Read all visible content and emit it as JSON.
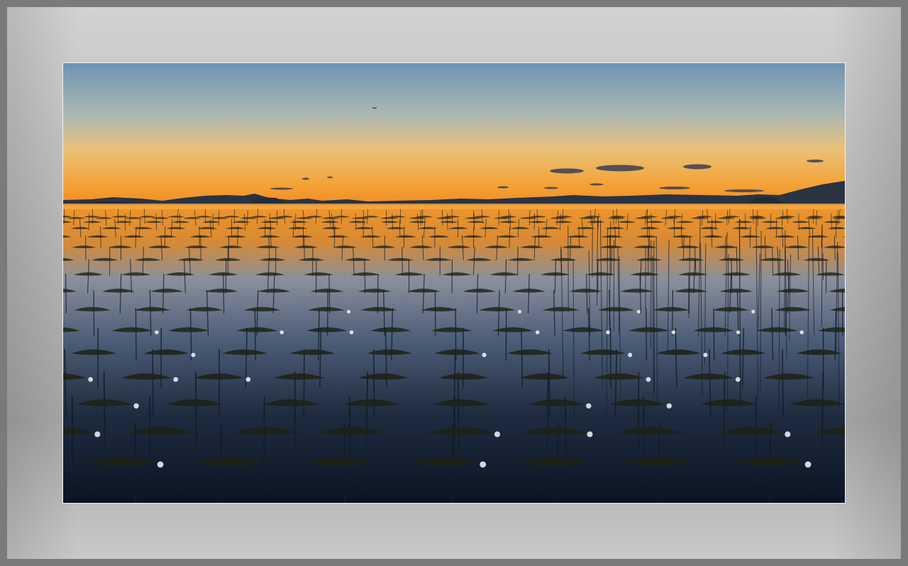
{
  "scene": {
    "subject": "seaweed-farm-at-sunset",
    "colors": {
      "sky_top": "#6f93b3",
      "sky_mid": "#d9c08a",
      "sky_horizon": "#f39a2c",
      "water_reflection": "#e8902a",
      "water_deep": "#0e1a2a",
      "frame": "#b5b5b5"
    }
  }
}
